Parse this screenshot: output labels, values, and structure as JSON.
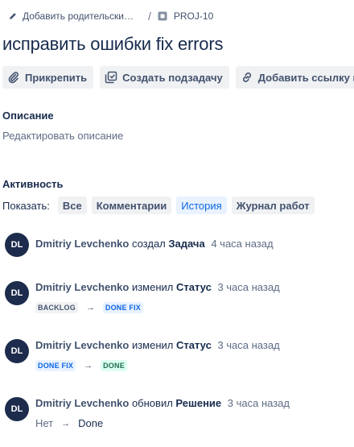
{
  "breadcrumb": {
    "parent_label": "Добавить родительски…",
    "separator": "/",
    "issue_key": "PROJ-10"
  },
  "issue": {
    "title": "исправить ошибки fix errors"
  },
  "toolbar": {
    "attach": "Прикрепить",
    "create_subtask": "Создать подзадачу",
    "add_link": "Добавить ссылку на"
  },
  "description": {
    "heading": "Описание",
    "placeholder": "Редактировать описание"
  },
  "activity": {
    "heading": "Активность",
    "show_label": "Показать:",
    "filters": [
      {
        "label": "Все",
        "active": false
      },
      {
        "label": "Комментарии",
        "active": false
      },
      {
        "label": "История",
        "active": true
      },
      {
        "label": "Журнал работ",
        "active": false
      }
    ],
    "entries": [
      {
        "initials": "DL",
        "user": "Dmitriy Levchenko",
        "action": "создал",
        "field": "Задача",
        "time": "4 часа назад"
      },
      {
        "initials": "DL",
        "user": "Dmitriy Levchenko",
        "action": "изменил",
        "field": "Статус",
        "time": "3 часа назад",
        "from": "BACKLOG",
        "to": "DONE FIX"
      },
      {
        "initials": "DL",
        "user": "Dmitriy Levchenko",
        "action": "изменил",
        "field": "Статус",
        "time": "3 часа назад",
        "from": "DONE FIX",
        "to": "DONE"
      },
      {
        "initials": "DL",
        "user": "Dmitriy Levchenko",
        "action": "обновил",
        "field": "Решение",
        "time": "3 часа назад",
        "from": "Нет",
        "to": "Done"
      }
    ],
    "arrow": "→"
  },
  "colors": {
    "avatar_bg": "#1d2c4c",
    "active_filter": "#0c66e4",
    "status_blue": "#0c66e4",
    "status_green": "#216e4e"
  }
}
